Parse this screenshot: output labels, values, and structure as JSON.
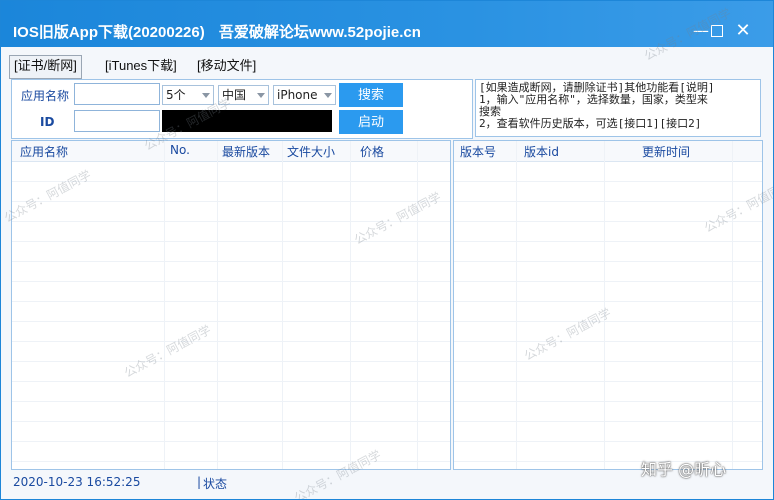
{
  "window": {
    "title": "IOS旧版App下载(20200226)",
    "forum": "吾爱破解论坛www.52pojie.cn",
    "close_glyph": "✕",
    "minimize_glyph": "—"
  },
  "tabs": [
    {
      "label": "[证书/断网]",
      "active": true
    },
    {
      "label": "[iTunes下载]",
      "active": false
    },
    {
      "label": "[移动文件]",
      "active": false
    }
  ],
  "form": {
    "app_name_label": "应用名称",
    "id_label": "ID",
    "app_name_value": "",
    "id_value": "",
    "count_select": "5个",
    "country_select": "中国",
    "device_select": "iPhone",
    "search_button": "搜索",
    "start_button": "启动"
  },
  "info": {
    "lines": [
      "[如果造成断网，请删除证书]其他功能看[说明]",
      "1，输入\"应用名称\"，选择数量，国家，类型来",
      "搜索",
      "2，查看软件历史版本，可选[接口1][接口2]"
    ]
  },
  "left_table": {
    "columns": [
      "应用名称",
      "No.",
      "最新版本",
      "文件大小",
      "价格"
    ],
    "rows": []
  },
  "right_table": {
    "columns": [
      "版本号",
      "版本id",
      "更新时间"
    ],
    "rows": []
  },
  "status": {
    "time": "2020-10-23 16:52:25",
    "separator": "|",
    "label": "状态"
  },
  "watermarks": {
    "repeated": "公众号：阿值同学",
    "corner": "知乎 @昕心"
  }
}
